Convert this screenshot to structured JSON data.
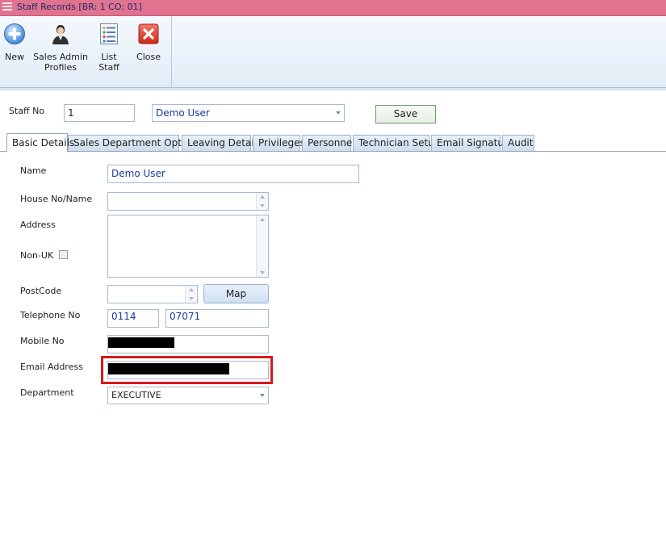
{
  "window": {
    "title": "Staff Records [BR: 1 CO: 01]"
  },
  "toolbar": {
    "new_label": "New",
    "sales_admin_label_1": "Sales Admin",
    "sales_admin_label_2": "Profiles",
    "list_staff_label": "List Staff",
    "close_label": "Close"
  },
  "header": {
    "staff_no_label": "Staff No",
    "staff_no_value": "1",
    "staff_name_value": "Demo User",
    "save_label": "Save"
  },
  "tabs": [
    {
      "label": "Basic Details",
      "active": true
    },
    {
      "label": "Sales Department Options"
    },
    {
      "label": "Leaving Details"
    },
    {
      "label": "Privileges"
    },
    {
      "label": "Personnel"
    },
    {
      "label": "Technician Setup"
    },
    {
      "label": "Email Signature"
    },
    {
      "label": "Audit"
    }
  ],
  "form": {
    "name_label": "Name",
    "name_value": "Demo User",
    "house_label": "House No/Name",
    "house_value": "",
    "address_label": "Address",
    "address_value": "",
    "non_uk_label": "Non-UK",
    "postcode_label": "PostCode",
    "postcode_value": "",
    "map_label": "Map",
    "telephone_label": "Telephone No",
    "telephone_area": "0114",
    "telephone_number": "07071",
    "mobile_label": "Mobile No",
    "email_label": "Email Address",
    "department_label": "Department",
    "department_value": "EXECUTIVE"
  },
  "colors": {
    "titlebar": "#e0738f",
    "highlight": "#d81a1a"
  }
}
